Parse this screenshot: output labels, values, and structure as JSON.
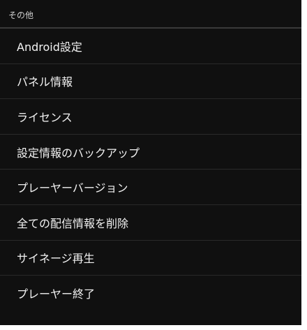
{
  "section": {
    "title": "その他"
  },
  "menu": {
    "items": [
      {
        "label": "Android設定"
      },
      {
        "label": "パネル情報"
      },
      {
        "label": "ライセンス"
      },
      {
        "label": "設定情報のバックアップ"
      },
      {
        "label": "プレーヤーバージョン"
      },
      {
        "label": "全ての配信情報を削除"
      },
      {
        "label": "サイネージ再生"
      },
      {
        "label": "プレーヤー終了"
      }
    ]
  },
  "colors": {
    "background": "#101010",
    "header_text": "#cfcfcf",
    "item_text": "#f2f2f2",
    "divider": "#2a2a2a"
  }
}
